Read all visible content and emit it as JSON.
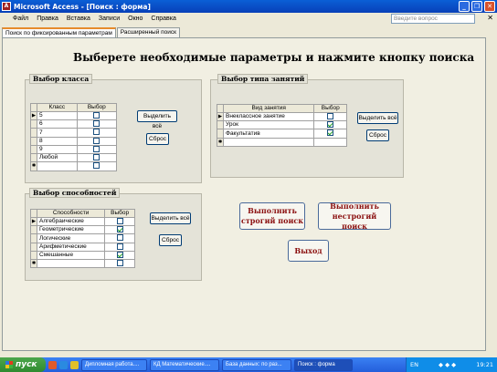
{
  "window": {
    "title": "Microsoft Access - [Поиск : форма]"
  },
  "menu": {
    "items": [
      "Файл",
      "Правка",
      "Вставка",
      "Записи",
      "Окно",
      "Справка"
    ],
    "help_placeholder": "Введите вопрос"
  },
  "tabs": [
    {
      "label": "Поиск по фиксированным параметрам"
    },
    {
      "label": "Расширенный поиск"
    }
  ],
  "form": {
    "heading": "Выберете необходимые параметры  и нажмите кнопку поиска"
  },
  "class_group": {
    "title": "Выбор класса",
    "headers": [
      "Класс",
      "Выбор"
    ],
    "rows": [
      {
        "label": "5",
        "checked": false
      },
      {
        "label": "6",
        "checked": false
      },
      {
        "label": "7",
        "checked": false
      },
      {
        "label": "8",
        "checked": false
      },
      {
        "label": "9",
        "checked": false
      },
      {
        "label": "Любой",
        "checked": false
      }
    ],
    "select_all_label": "Выделить всё",
    "reset_label": "Сброс"
  },
  "activity_group": {
    "title": "Выбор типа занятий",
    "headers": [
      "Вид занятия",
      "Выбор"
    ],
    "rows": [
      {
        "label": "Внеклассное занятие",
        "checked": false
      },
      {
        "label": "Урок",
        "checked": true
      },
      {
        "label": "Факультатив",
        "checked": true
      }
    ],
    "select_all_label": "Выделить всё",
    "reset_label": "Сброс"
  },
  "ability_group": {
    "title": "Выбор способностей",
    "headers": [
      "Способности",
      "Выбор"
    ],
    "rows": [
      {
        "label": "Алгебраические",
        "checked": false
      },
      {
        "label": "Геометрические",
        "checked": true
      },
      {
        "label": "Логические",
        "checked": false
      },
      {
        "label": "Арифметические",
        "checked": false
      },
      {
        "label": "Смешанные",
        "checked": true
      }
    ],
    "select_all_label": "Выделить всё",
    "reset_label": "Сброс"
  },
  "actions": {
    "strict_search": "Выполнить строгий поиск",
    "loose_search": "Выполнить нестрогий поиск",
    "exit": "Выход"
  },
  "taskbar": {
    "start_label": "пуск",
    "tasks": [
      "Дипломная работа....",
      "КД Математические....",
      "База данных: по раз...",
      "Поиск : форма"
    ],
    "lang": "EN",
    "clock": "19:21"
  }
}
